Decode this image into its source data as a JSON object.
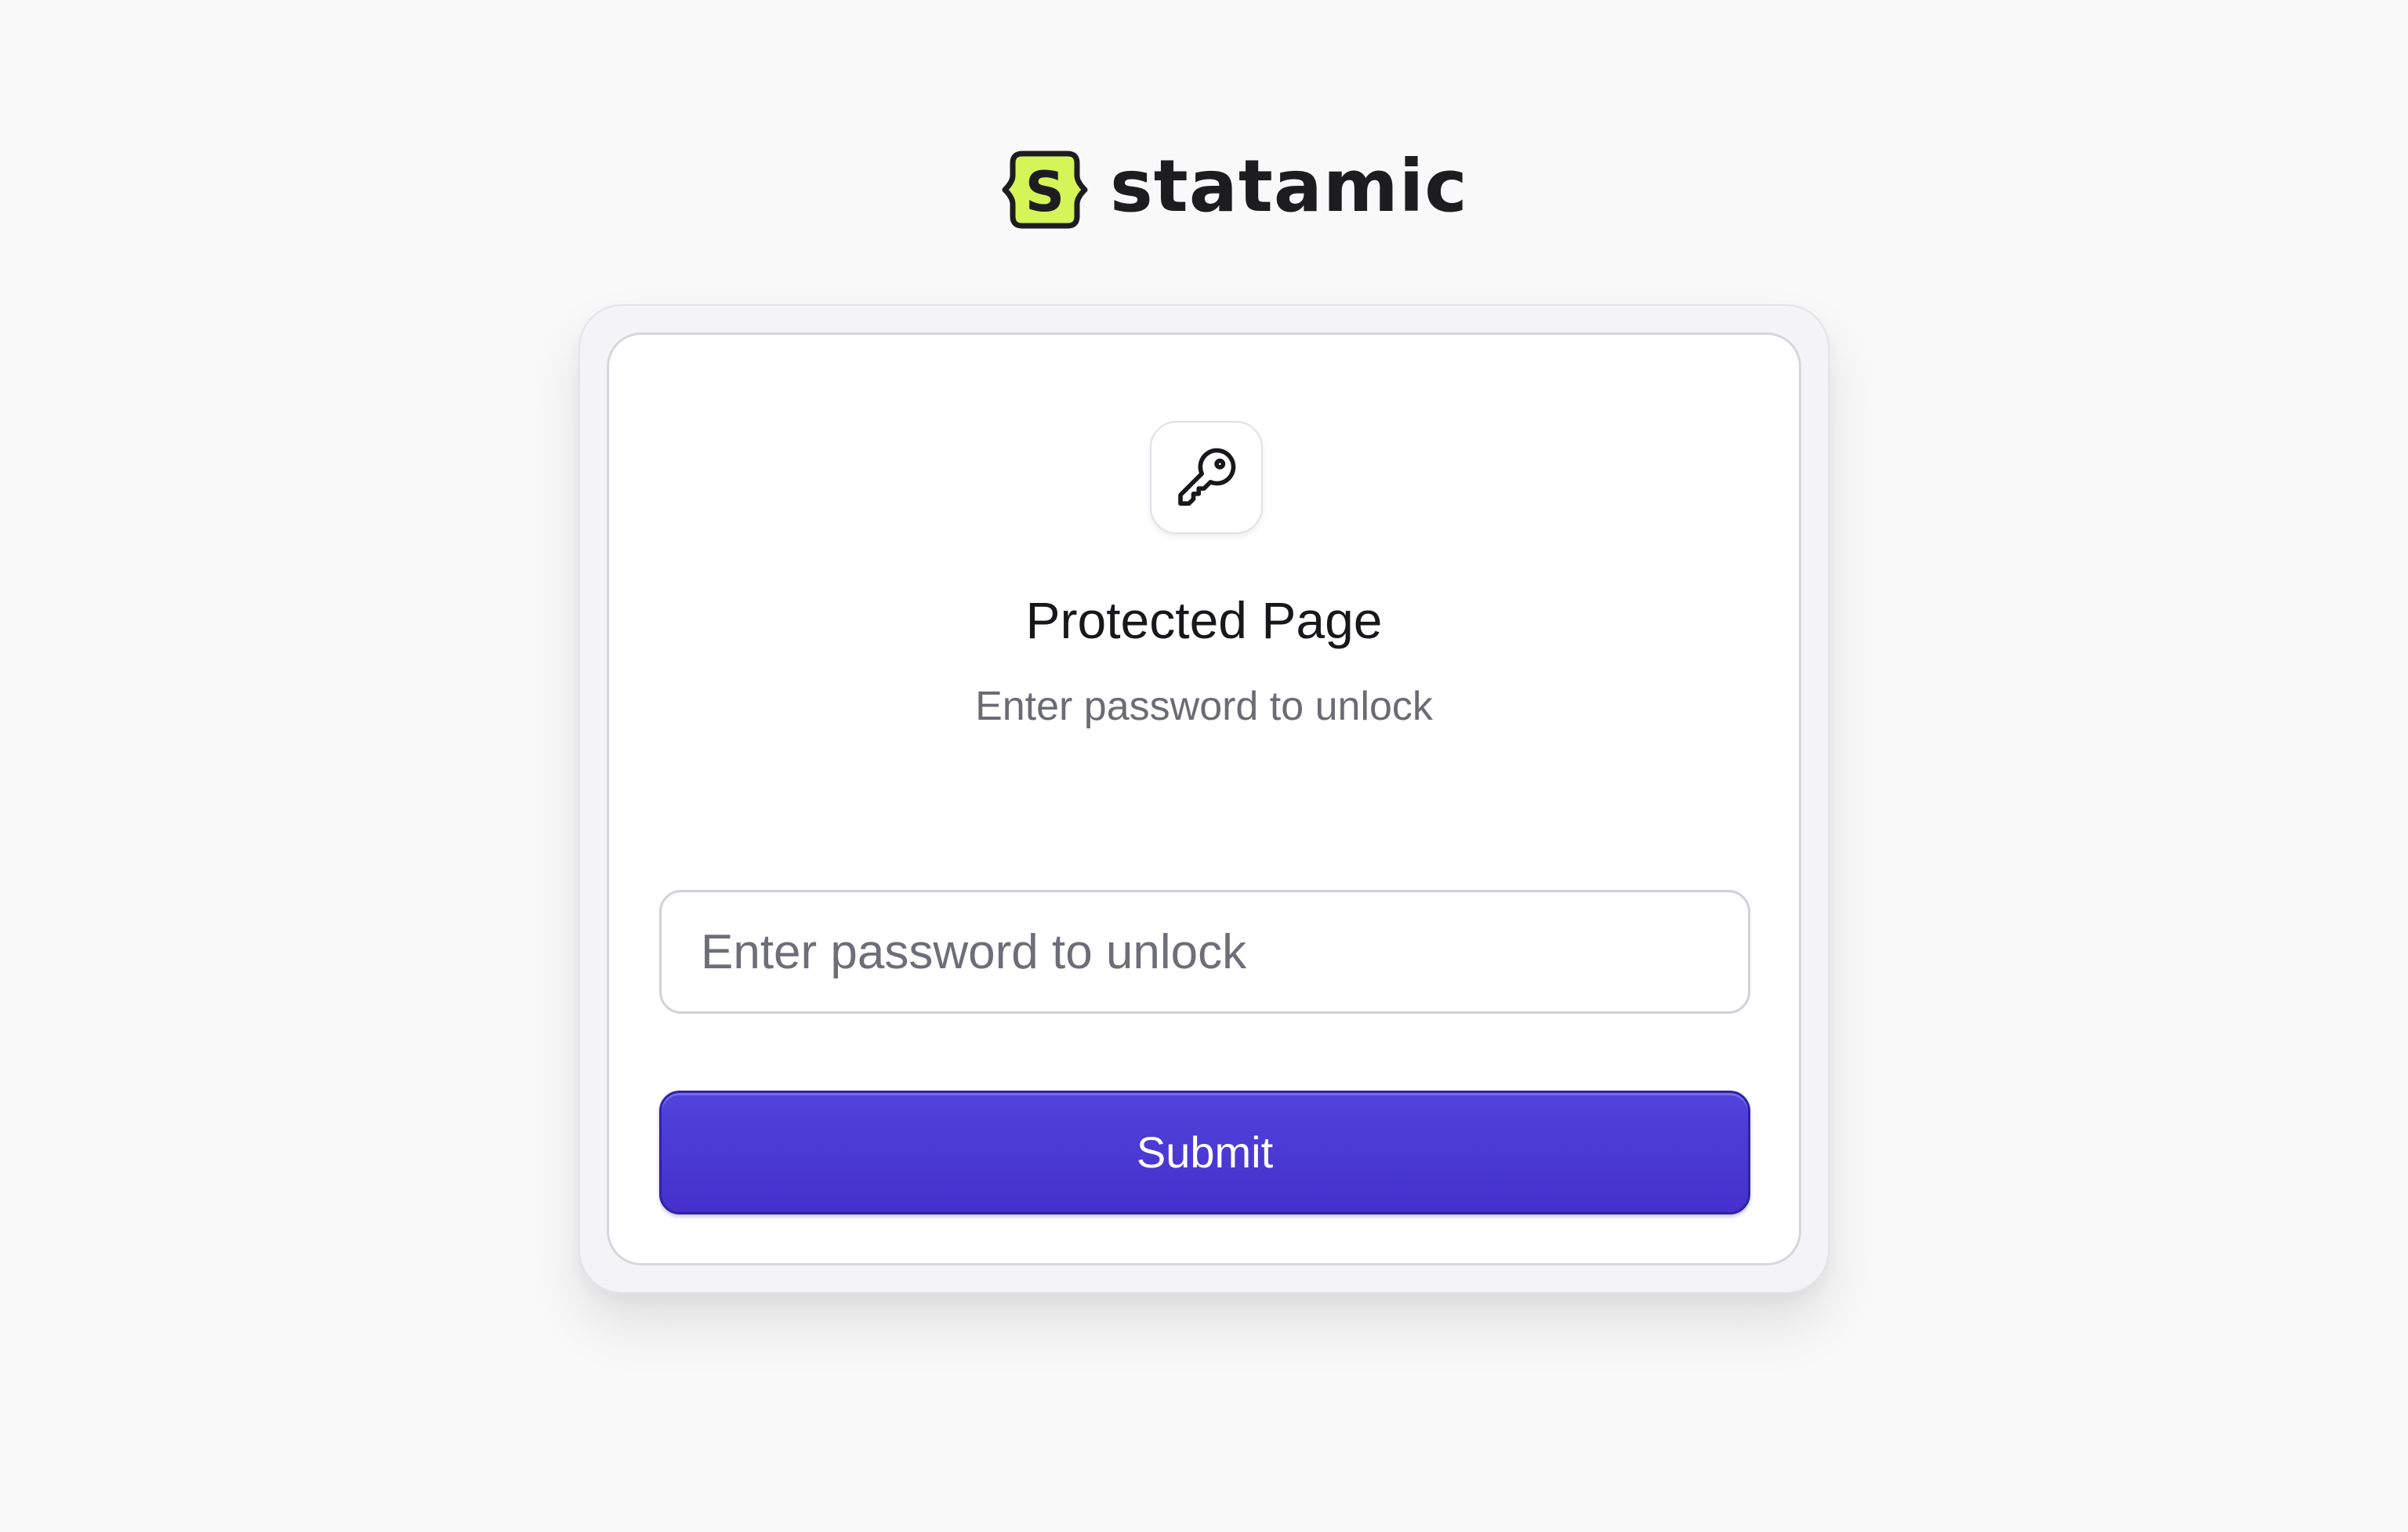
{
  "brand": {
    "name": "statamic",
    "mark_letter": "S",
    "mark_color": "#d4f458",
    "mark_outline": "#1d1d1f",
    "logo_icon": "statamic-logo-icon"
  },
  "card": {
    "icon": "key-icon",
    "title": "Protected Page",
    "subtitle": "Enter password to unlock"
  },
  "form": {
    "password": {
      "placeholder": "Enter password to unlock",
      "value": ""
    },
    "submit_label": "Submit"
  },
  "colors": {
    "accent": "#4a38d4",
    "background": "#f9f9fa",
    "text_primary": "#18181b",
    "text_muted": "#6b6b74"
  }
}
